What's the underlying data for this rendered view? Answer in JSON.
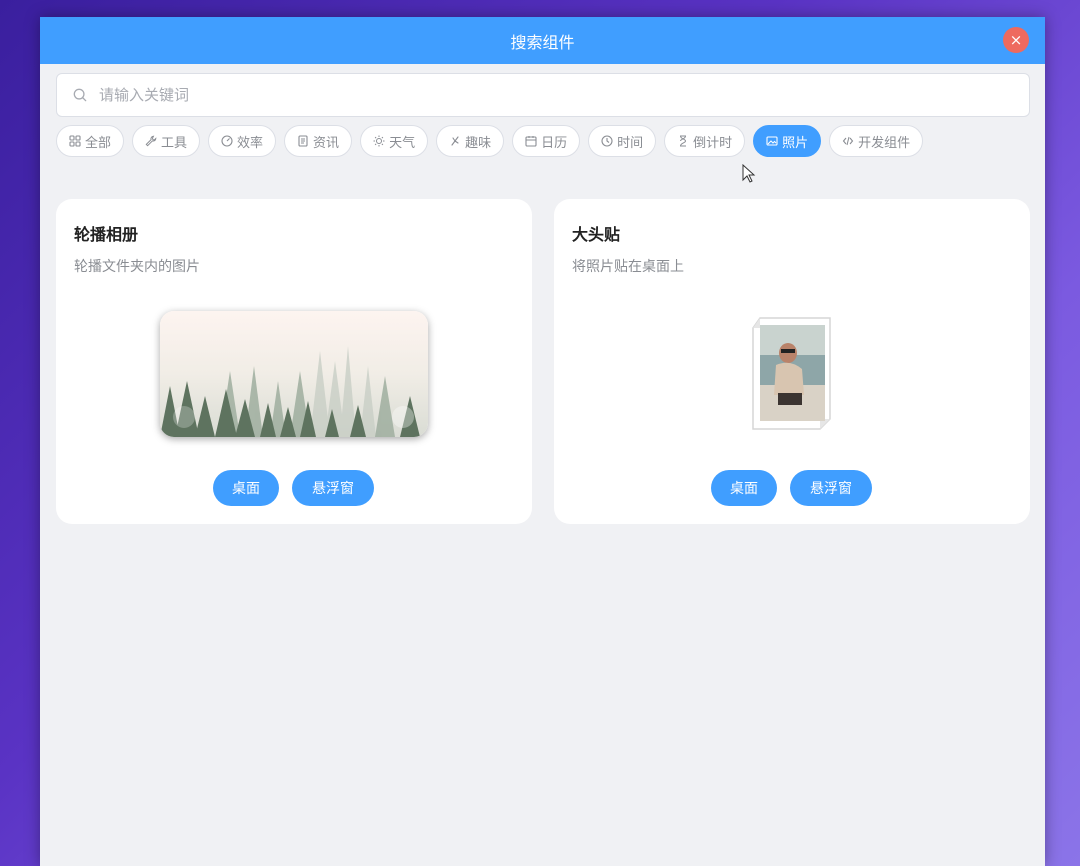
{
  "window": {
    "title": "搜索组件",
    "close_label": "×"
  },
  "search": {
    "placeholder": "请输入关键词",
    "icon": "search-icon"
  },
  "categories": [
    {
      "label": "全部",
      "icon": "grid-icon"
    },
    {
      "label": "工具",
      "icon": "wrench-icon"
    },
    {
      "label": "效率",
      "icon": "gauge-icon"
    },
    {
      "label": "资讯",
      "icon": "news-icon"
    },
    {
      "label": "天气",
      "icon": "sun-icon"
    },
    {
      "label": "趣味",
      "icon": "sparkle-icon"
    },
    {
      "label": "日历",
      "icon": "calendar-icon"
    },
    {
      "label": "时间",
      "icon": "clock-icon"
    },
    {
      "label": "倒计时",
      "icon": "hourglass-icon"
    },
    {
      "label": "照片",
      "icon": "image-icon",
      "active": true
    },
    {
      "label": "开发组件",
      "icon": "code-icon"
    }
  ],
  "widgets": [
    {
      "title": "轮播相册",
      "description": "轮播文件夹内的图片",
      "buttons": [
        "桌面",
        "悬浮窗"
      ]
    },
    {
      "title": "大头贴",
      "description": "将照片贴在桌面上",
      "buttons": [
        "桌面",
        "悬浮窗"
      ]
    }
  ],
  "colors": {
    "accent": "#409eff",
    "close": "#ee6a5f",
    "background": "#f0f1f4"
  }
}
